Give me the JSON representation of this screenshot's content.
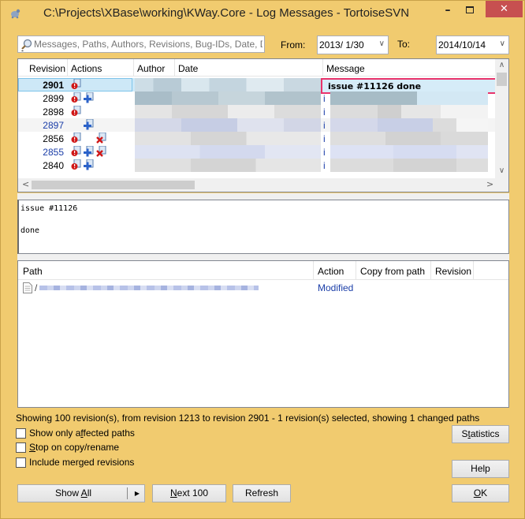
{
  "window": {
    "title": "C:\\Projects\\XBase\\working\\KWay.Core - Log Messages - TortoiseSVN",
    "minimize_label": "–",
    "close_label": "✕"
  },
  "filter": {
    "search_placeholder": "Messages, Paths, Authors, Revisions, Bug-IDs, Date, D",
    "search_value": "",
    "from_label": "From:",
    "from_value": "2013/ 1/30",
    "to_label": "To:",
    "to_value": "2014/10/14"
  },
  "revision_list": {
    "columns": [
      "Revision",
      "Actions",
      "Author",
      "Date",
      "Message"
    ],
    "rows": [
      {
        "revision": "2901",
        "actions": [
          "modified"
        ],
        "message": "issue #11126  done",
        "selected": true
      },
      {
        "revision": "2899",
        "actions": [
          "modified",
          "added"
        ],
        "message": "i"
      },
      {
        "revision": "2898",
        "actions": [
          "modified"
        ],
        "message": "i"
      },
      {
        "revision": "2897",
        "actions": [
          "added"
        ],
        "message": "i"
      },
      {
        "revision": "2856",
        "actions": [
          "modified",
          "deleted"
        ],
        "message": "i"
      },
      {
        "revision": "2855",
        "actions": [
          "modified",
          "added",
          "deleted"
        ],
        "message": "i"
      },
      {
        "revision": "2840",
        "actions": [
          "modified",
          "added"
        ],
        "message": "i"
      }
    ]
  },
  "message_box": {
    "text": "issue #11126\n\ndone"
  },
  "changed_paths": {
    "columns": [
      "Path",
      "Action",
      "Copy from path",
      "Revision"
    ],
    "rows": [
      {
        "path": "/",
        "action": "Modified",
        "copy_from": "",
        "revision": ""
      }
    ]
  },
  "status_text": "Showing 100 revision(s), from revision 1213 to revision 2901 - 1 revision(s) selected, showing 1 changed paths",
  "options": [
    {
      "pre": "Show only a",
      "key": "f",
      "post": "fected paths",
      "checked": false
    },
    {
      "pre": "",
      "key": "S",
      "post": "top on copy/rename",
      "checked": false
    },
    {
      "pre": "Include merged revisions",
      "key": "",
      "post": "",
      "checked": false
    }
  ],
  "buttons": {
    "statistics": {
      "pre": "S",
      "key": "t",
      "post": "atistics"
    },
    "help": "Help",
    "show_all": {
      "pre": "Show ",
      "key": "A",
      "post": "ll"
    },
    "next_100": {
      "pre": "",
      "key": "N",
      "post": "ext 100"
    },
    "refresh": "Refresh",
    "ok": {
      "pre": "",
      "key": "O",
      "post": "K"
    }
  },
  "colors": {
    "window_bg": "#f1cb6f",
    "selection_bg": "#cde8f7",
    "highlight_border": "#e8336b",
    "link_blue": "#1b3ea8",
    "close_red": "#c75050"
  }
}
